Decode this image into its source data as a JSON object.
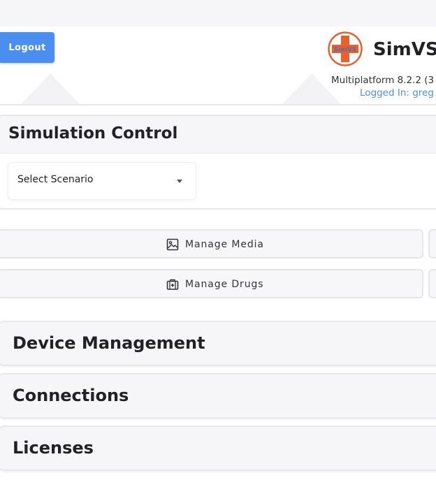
{
  "header": {
    "logout_label": "Logout",
    "logo_text": "SimVS",
    "app_name": "SimVS",
    "version": "Multiplatform 8.2.2 (3",
    "logged_in": "Logged In: greg"
  },
  "simulation_control": {
    "title": "Simulation Control",
    "scenario_select": {
      "placeholder": "Select Scenario"
    }
  },
  "manage_buttons": [
    {
      "label": "Manage Media",
      "icon": "image-icon"
    },
    {
      "label": "Manage Drugs",
      "icon": "medkit-icon"
    }
  ],
  "sections": [
    {
      "title": "Device Management"
    },
    {
      "title": "Connections"
    },
    {
      "title": "Licenses"
    }
  ],
  "colors": {
    "accent": "#4a8ef0",
    "logo_orange": "#e8602c",
    "panel_bg": "#f6f6f8",
    "text": "#222226"
  }
}
